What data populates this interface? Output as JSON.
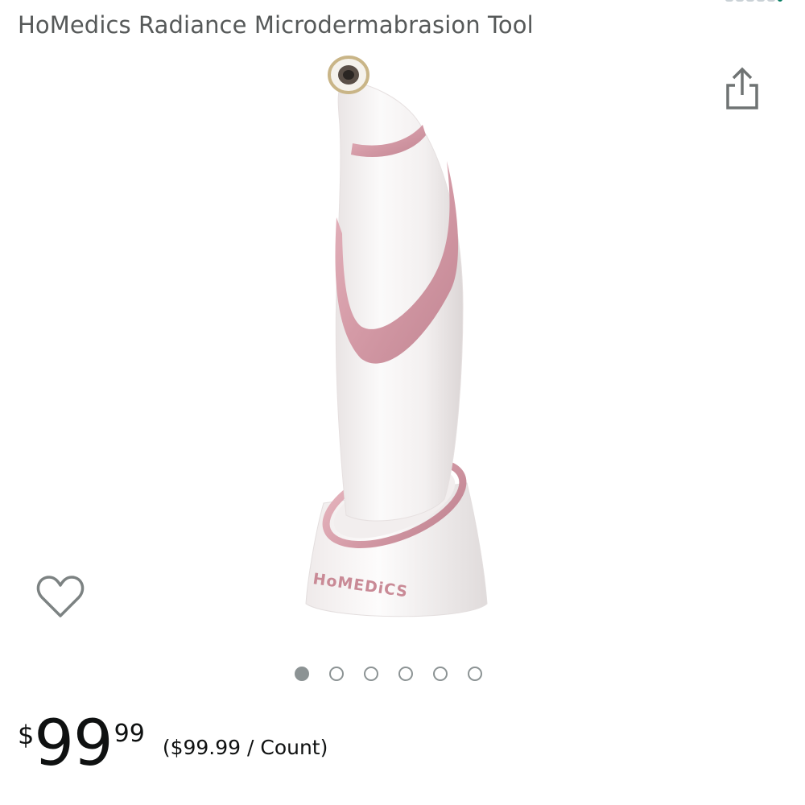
{
  "product": {
    "title": "HoMedics Radiance Microdermabrasion Tool",
    "image_brand_text": "HoMEDiCS"
  },
  "gallery": {
    "image_count": 6,
    "active_index": 0
  },
  "price": {
    "symbol": "$",
    "whole": "99",
    "fraction": "99",
    "unit_price": "($99.99 / Count)"
  },
  "colors": {
    "title_text": "#565959",
    "price_text": "#0f1111",
    "icon_gray": "#6f7373",
    "dot_gray": "#8c9394",
    "rose_gold": "#d9a3ad",
    "device_white": "#f7f4f4"
  },
  "icons": {
    "share": "share-icon",
    "wishlist": "heart-outline-icon"
  }
}
